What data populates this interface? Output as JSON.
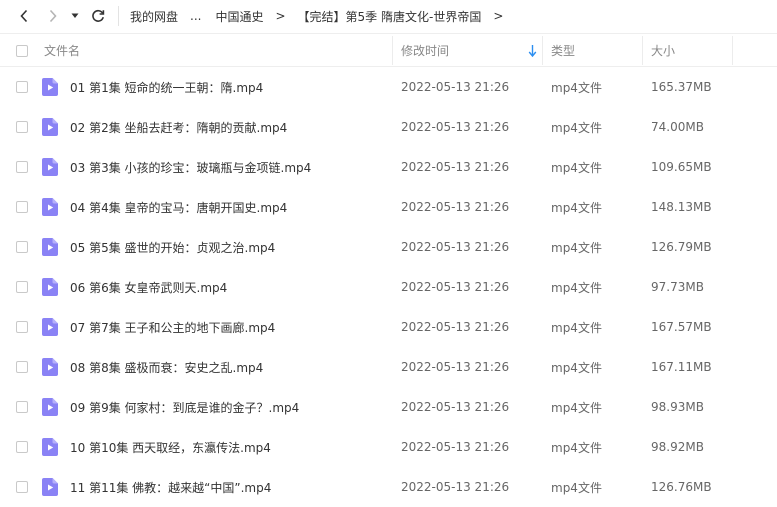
{
  "breadcrumb": {
    "root": "我的网盘",
    "ellipsis": "...",
    "items": [
      "中国通史",
      "【完结】第5季 隋唐文化-世界帝国"
    ]
  },
  "columns": {
    "name": "文件名",
    "modified": "修改时间",
    "type": "类型",
    "size": "大小"
  },
  "sort": {
    "column": "modified",
    "direction": "descending"
  },
  "accent_color": "#2b8ef0",
  "file_icon_color": "#8a82f5",
  "files": [
    {
      "name": "01 第1集 短命的统一王朝：隋.mp4",
      "modified": "2022-05-13 21:26",
      "type": "mp4文件",
      "size": "165.37MB"
    },
    {
      "name": "02 第2集 坐船去赶考：隋朝的贡献.mp4",
      "modified": "2022-05-13 21:26",
      "type": "mp4文件",
      "size": "74.00MB"
    },
    {
      "name": "03 第3集 小孩的珍宝：玻璃瓶与金项链.mp4",
      "modified": "2022-05-13 21:26",
      "type": "mp4文件",
      "size": "109.65MB"
    },
    {
      "name": "04 第4集 皇帝的宝马：唐朝开国史.mp4",
      "modified": "2022-05-13 21:26",
      "type": "mp4文件",
      "size": "148.13MB"
    },
    {
      "name": "05 第5集 盛世的开始：贞观之治.mp4",
      "modified": "2022-05-13 21:26",
      "type": "mp4文件",
      "size": "126.79MB"
    },
    {
      "name": "06 第6集 女皇帝武则天.mp4",
      "modified": "2022-05-13 21:26",
      "type": "mp4文件",
      "size": "97.73MB"
    },
    {
      "name": "07 第7集 王子和公主的地下画廊.mp4",
      "modified": "2022-05-13 21:26",
      "type": "mp4文件",
      "size": "167.57MB"
    },
    {
      "name": "08 第8集 盛极而衰：安史之乱.mp4",
      "modified": "2022-05-13 21:26",
      "type": "mp4文件",
      "size": "167.11MB"
    },
    {
      "name": "09 第9集 何家村：到底是谁的金子？.mp4",
      "modified": "2022-05-13 21:26",
      "type": "mp4文件",
      "size": "98.93MB"
    },
    {
      "name": "10 第10集 西天取经，东瀛传法.mp4",
      "modified": "2022-05-13 21:26",
      "type": "mp4文件",
      "size": "98.92MB"
    },
    {
      "name": "11 第11集 佛教：越来越“中国”.mp4",
      "modified": "2022-05-13 21:26",
      "type": "mp4文件",
      "size": "126.76MB"
    }
  ]
}
